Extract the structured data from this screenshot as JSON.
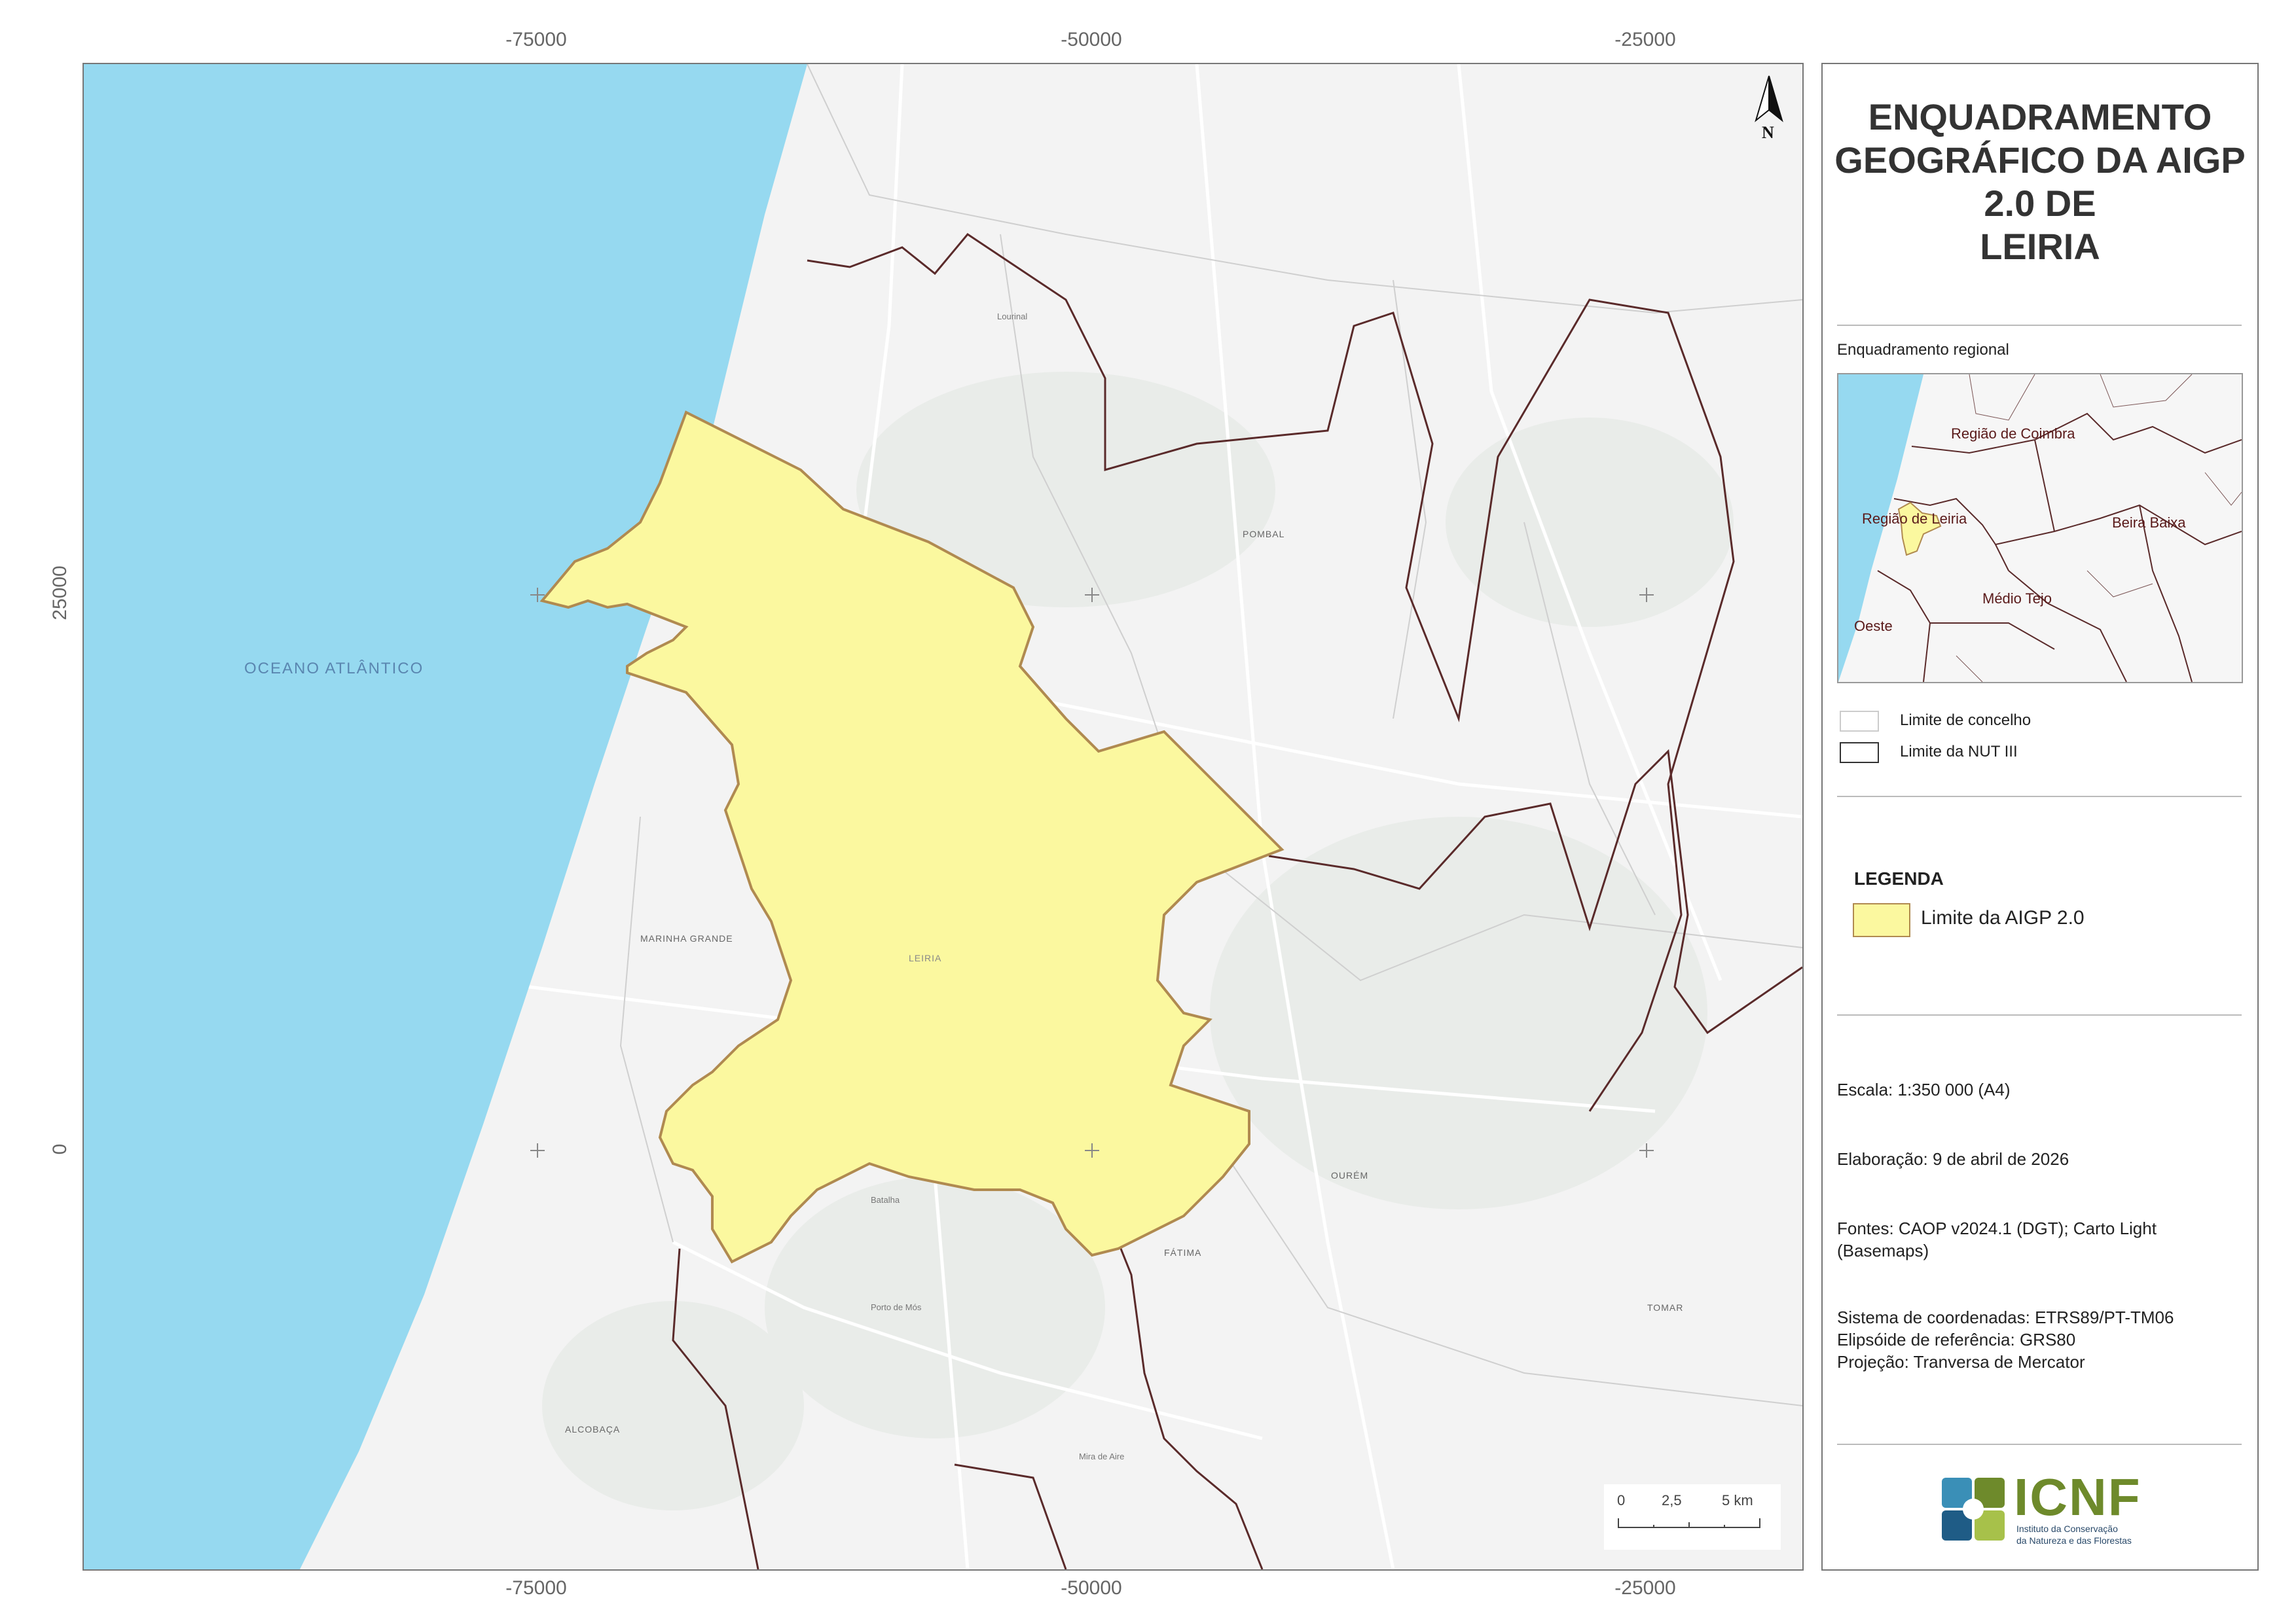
{
  "axis_ticks": {
    "x_top": [
      "-75000",
      "-50000",
      "-25000"
    ],
    "x_bottom": [
      "-75000",
      "-50000",
      "-25000"
    ],
    "y_left": [
      "25000",
      "0"
    ]
  },
  "map": {
    "ocean_label": "OCEANO ATLÂNTICO",
    "north_label": "N",
    "colors": {
      "ocean": "#96d9f0",
      "land": "#f3f3f3",
      "aigp_fill": "#fbf89f",
      "aigp_stroke": "#b08a50",
      "nut_boundary": "#5a2a2a"
    },
    "place_labels": [
      "POMBAL",
      "LEIRIA",
      "MARINHA GRANDE",
      "OURÉM",
      "FÁTIMA",
      "ALCOBAÇA",
      "TOMAR",
      "Lourinal",
      "Batalha",
      "Porto de Mós",
      "Mira de Aire"
    ],
    "scale_bar": {
      "labels": [
        "0",
        "2,5",
        "5 km"
      ]
    }
  },
  "panel": {
    "title_lines": [
      "ENQUADRAMENTO",
      "GEOGRÁFICO DA AIGP",
      "2.0 DE",
      "LEIRIA"
    ],
    "inset_heading": "Enquadramento regional",
    "inset_regions": [
      "Região de Coimbra",
      "Região de Leiria",
      "Beira Baixa",
      "Médio Tejo",
      "Oeste"
    ],
    "legend_small": [
      {
        "label": "Limite de concelho"
      },
      {
        "label": "Limite da NUT III"
      }
    ],
    "legend_heading": "LEGENDA",
    "legend_item": "Limite da AIGP 2.0",
    "scale_text": "Escala: 1:350 000 (A4)",
    "date_text": "Elaboração: 9 de abril de 2026",
    "sources_lines": [
      "Fontes: CAOP v2024.1 (DGT); Carto Light",
      "(Basemaps)"
    ],
    "crs_lines": [
      "Sistema de coordenadas: ETRS89/PT-TM06",
      "Elipsóide de referência: GRS80",
      "Projeção: Tranversa de Mercator"
    ],
    "logo_title": "ICNF",
    "logo_subtitle_lines": [
      "Instituto da Conservação",
      "da Natureza e das Florestas"
    ],
    "logo_colors": [
      "#3a8fb7",
      "#6e8a2b",
      "#a7c14a",
      "#1f5c86"
    ]
  }
}
